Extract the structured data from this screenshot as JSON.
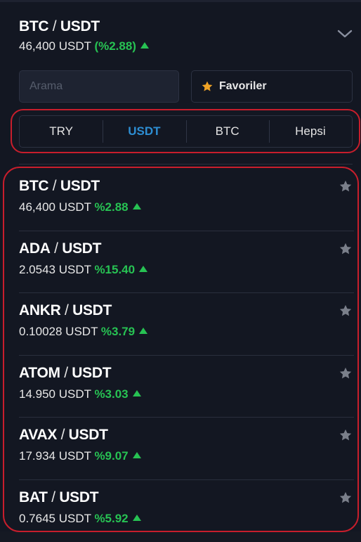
{
  "header": {
    "base": "BTC",
    "separator": " / ",
    "quote": "USDT",
    "price": "46,400 USDT",
    "change": "(%2.88)"
  },
  "search": {
    "placeholder": "Arama",
    "value": ""
  },
  "favorites": {
    "label": "Favoriler"
  },
  "tabs": [
    {
      "label": "TRY",
      "active": false
    },
    {
      "label": "USDT",
      "active": true
    },
    {
      "label": "BTC",
      "active": false
    },
    {
      "label": "Hepsi",
      "active": false
    }
  ],
  "pairs": [
    {
      "base": "BTC",
      "separator": " / ",
      "quote": "USDT",
      "price": "46,400 USDT",
      "change": "%2.88"
    },
    {
      "base": "ADA",
      "separator": " / ",
      "quote": "USDT",
      "price": "2.0543 USDT",
      "change": "%15.40"
    },
    {
      "base": "ANKR",
      "separator": " / ",
      "quote": "USDT",
      "price": "0.10028 USDT",
      "change": "%3.79"
    },
    {
      "base": "ATOM",
      "separator": " / ",
      "quote": "USDT",
      "price": "14.950 USDT",
      "change": "%3.03"
    },
    {
      "base": "AVAX",
      "separator": " / ",
      "quote": "USDT",
      "price": "17.934 USDT",
      "change": "%9.07"
    },
    {
      "base": "BAT",
      "separator": " / ",
      "quote": "USDT",
      "price": "0.7645 USDT",
      "change": "%5.92"
    }
  ],
  "colors": {
    "background": "#131722",
    "positive": "#27c253",
    "active_tab": "#2d8ed3",
    "highlight": "#c81e2c",
    "favorite_star": "#f0a326",
    "inactive_star": "#7a7f8a"
  },
  "icons": {
    "chevron": "chevron-down-icon",
    "favorite": "star-icon",
    "trend": "triangle-up-icon"
  }
}
